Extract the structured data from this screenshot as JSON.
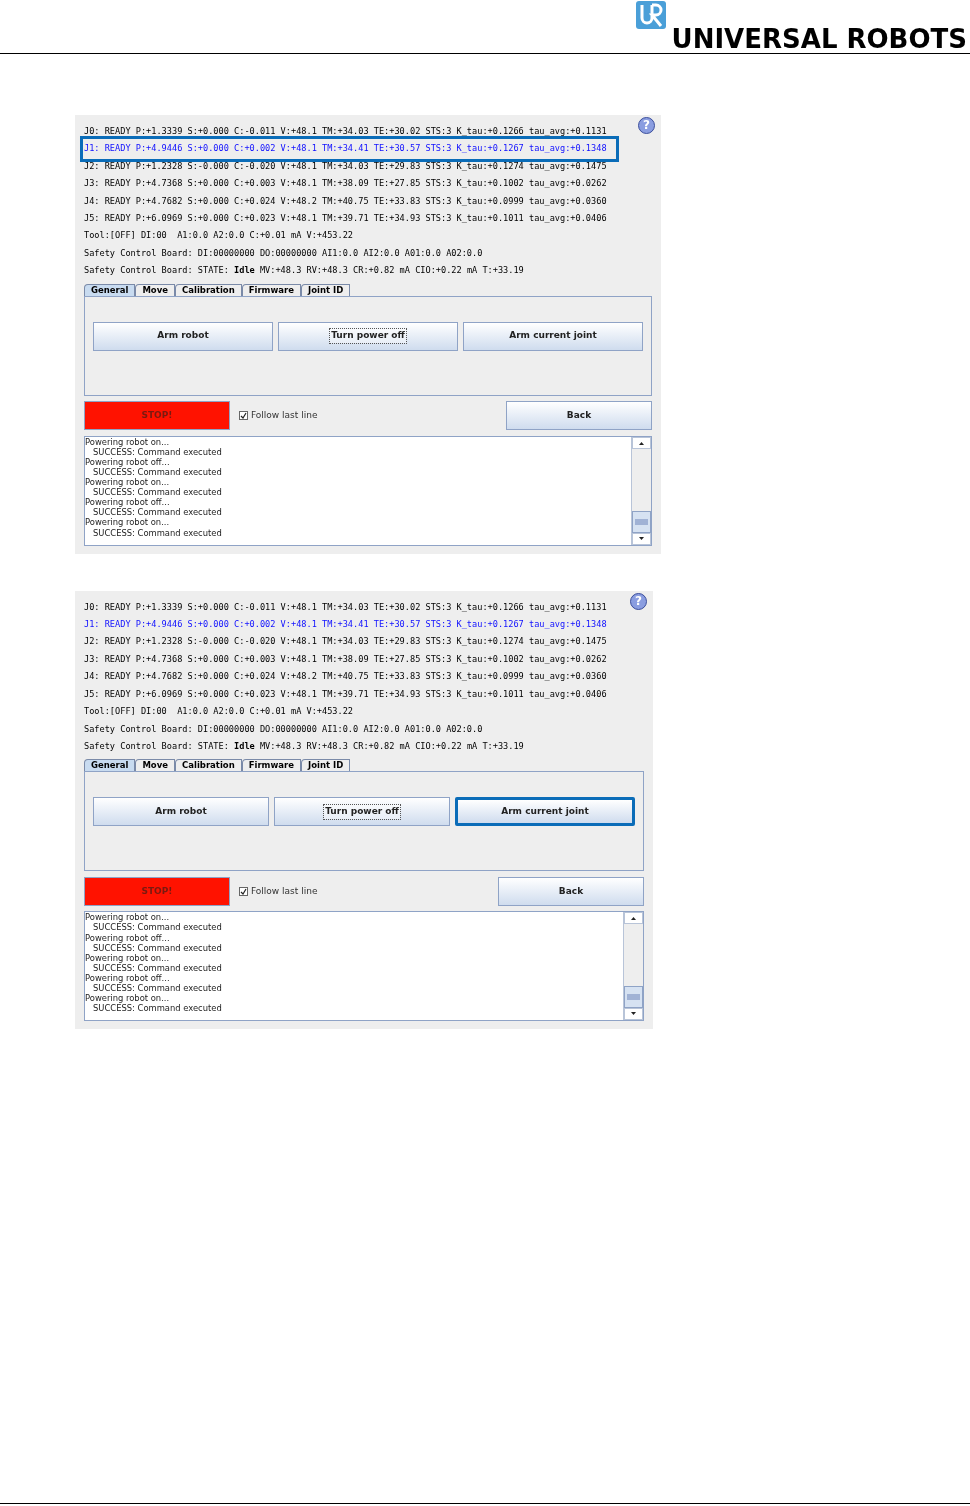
{
  "header": {
    "logo_text": "UNIVERSAL ROBOTS"
  },
  "screenshots": [
    {
      "help": "?",
      "joint_lines": [
        {
          "text": "J0: READY P:+1.3339 S:+0.000 C:-0.011 V:+48.1 TM:+34.03 TE:+30.02 STS:3 K_tau:+0.1266 tau_avg:+0.1131",
          "selected": false,
          "highlighted": false
        },
        {
          "text": "J1: READY P:+4.9446 S:+0.000 C:+0.002 V:+48.1 TM:+34.41 TE:+30.57 STS:3 K_tau:+0.1267 tau_avg:+0.1348",
          "selected": true,
          "highlighted": true
        },
        {
          "text": "J2: READY P:+1.2328 S:-0.000 C:-0.020 V:+48.1 TM:+34.03 TE:+29.83 STS:3 K_tau:+0.1274 tau_avg:+0.1475",
          "selected": false,
          "highlighted": false
        },
        {
          "text": "J3: READY P:+4.7368 S:+0.000 C:+0.003 V:+48.1 TM:+38.09 TE:+27.85 STS:3 K_tau:+0.1002 tau_avg:+0.0262",
          "selected": false,
          "highlighted": false
        },
        {
          "text": "J4: READY P:+4.7682 S:+0.000 C:+0.024 V:+48.2 TM:+40.75 TE:+33.83 STS:3 K_tau:+0.0999 tau_avg:+0.0360",
          "selected": false,
          "highlighted": false
        },
        {
          "text": "J5: READY P:+6.0969 S:+0.000 C:+0.023 V:+48.1 TM:+39.71 TE:+34.93 STS:3 K_tau:+0.1011 tau_avg:+0.0406",
          "selected": false,
          "highlighted": false
        }
      ],
      "tool_line": "Tool:[OFF] DI:00  A1:0.0 A2:0.0 C:+0.01 mA V:+453.22",
      "safety_lines": [
        "Safety Control Board: DI:00000000 DO:00000000 AI1:0.0 AI2:0.0 A01:0.0 A02:0.0",
        "Safety Control Board: STATE: **Idle** MV:+48.3 RV:+48.3 CR:+0.82 mA CIO:+0.22 mA T:+33.19"
      ],
      "tabs": [
        {
          "label": "General",
          "selected": true
        },
        {
          "label": "Move",
          "selected": false
        },
        {
          "label": "Calibration",
          "selected": false
        },
        {
          "label": "Firmware",
          "selected": false
        },
        {
          "label": "Joint ID",
          "selected": false
        }
      ],
      "buttons": [
        {
          "label": "Arm robot",
          "focused": false,
          "highlighted": false
        },
        {
          "label": "Turn power off",
          "focused": true,
          "highlighted": false
        },
        {
          "label": "Arm current joint",
          "focused": false,
          "highlighted": false
        }
      ],
      "stop_button": "STOP!",
      "follow": {
        "label": "Follow last line",
        "checked": true
      },
      "back_button": "Back",
      "log": [
        "Powering robot on...",
        "   SUCCESS: Command executed",
        "Powering robot off...",
        "   SUCCESS: Command executed",
        "Powering robot on...",
        "   SUCCESS: Command executed",
        "Powering robot off...",
        "   SUCCESS: Command executed",
        "Powering robot on...",
        "   SUCCESS: Command executed"
      ]
    },
    {
      "help": "?",
      "joint_lines": [
        {
          "text": "J0: READY P:+1.3339 S:+0.000 C:-0.011 V:+48.1 TM:+34.03 TE:+30.02 STS:3 K_tau:+0.1266 tau_avg:+0.1131",
          "selected": false,
          "highlighted": false
        },
        {
          "text": "J1: READY P:+4.9446 S:+0.000 C:+0.002 V:+48.1 TM:+34.41 TE:+30.57 STS:3 K_tau:+0.1267 tau_avg:+0.1348",
          "selected": true,
          "highlighted": false
        },
        {
          "text": "J2: READY P:+1.2328 S:-0.000 C:-0.020 V:+48.1 TM:+34.03 TE:+29.83 STS:3 K_tau:+0.1274 tau_avg:+0.1475",
          "selected": false,
          "highlighted": false
        },
        {
          "text": "J3: READY P:+4.7368 S:+0.000 C:+0.003 V:+48.1 TM:+38.09 TE:+27.85 STS:3 K_tau:+0.1002 tau_avg:+0.0262",
          "selected": false,
          "highlighted": false
        },
        {
          "text": "J4: READY P:+4.7682 S:+0.000 C:+0.024 V:+48.2 TM:+40.75 TE:+33.83 STS:3 K_tau:+0.0999 tau_avg:+0.0360",
          "selected": false,
          "highlighted": false
        },
        {
          "text": "J5: READY P:+6.0969 S:+0.000 C:+0.023 V:+48.1 TM:+39.71 TE:+34.93 STS:3 K_tau:+0.1011 tau_avg:+0.0406",
          "selected": false,
          "highlighted": false
        }
      ],
      "tool_line": "Tool:[OFF] DI:00  A1:0.0 A2:0.0 C:+0.01 mA V:+453.22",
      "safety_lines": [
        "Safety Control Board: DI:00000000 DO:00000000 AI1:0.0 AI2:0.0 A01:0.0 A02:0.0",
        "Safety Control Board: STATE: **Idle** MV:+48.3 RV:+48.3 CR:+0.82 mA CIO:+0.22 mA T:+33.19"
      ],
      "tabs": [
        {
          "label": "General",
          "selected": true
        },
        {
          "label": "Move",
          "selected": false
        },
        {
          "label": "Calibration",
          "selected": false
        },
        {
          "label": "Firmware",
          "selected": false
        },
        {
          "label": "Joint ID",
          "selected": false
        }
      ],
      "buttons": [
        {
          "label": "Arm robot",
          "focused": false,
          "highlighted": false
        },
        {
          "label": "Turn power off",
          "focused": true,
          "highlighted": false
        },
        {
          "label": "Arm current joint",
          "focused": false,
          "highlighted": true
        }
      ],
      "stop_button": "STOP!",
      "follow": {
        "label": "Follow last line",
        "checked": true
      },
      "back_button": "Back",
      "log": [
        "Powering robot on...",
        "   SUCCESS: Command executed",
        "Powering robot off...",
        "   SUCCESS: Command executed",
        "Powering robot on...",
        "   SUCCESS: Command executed",
        "Powering robot off...",
        "   SUCCESS: Command executed",
        "Powering robot on...",
        "   SUCCESS: Command executed"
      ]
    }
  ]
}
